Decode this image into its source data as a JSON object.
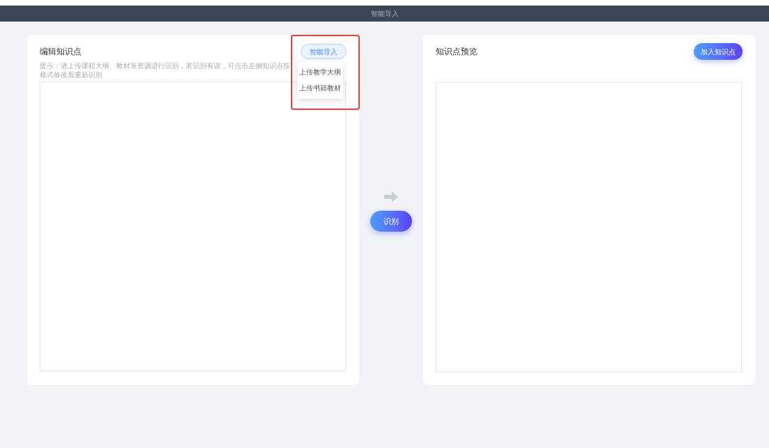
{
  "window": {
    "title": "智能导入"
  },
  "editor": {
    "title": "编辑知识点",
    "hint": "提示：请上传课程大纲、教材等资源进行识别，若识别有误，可点击左侧知识点按格式修改后重新识别",
    "import_button": "智能导入",
    "menu": {
      "expanded": true,
      "items": [
        "上传教学大纲",
        "上传书籍教材"
      ]
    },
    "highlighted": true
  },
  "recognize_button": "识别",
  "preview": {
    "title": "知识点预览",
    "add_button": "加入知识点"
  }
}
